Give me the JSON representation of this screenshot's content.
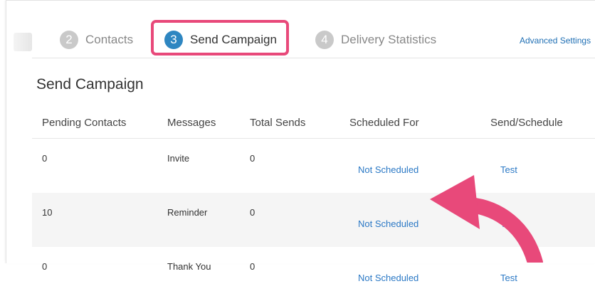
{
  "tabs": [
    {
      "step": "2",
      "label": "Contacts"
    },
    {
      "step": "3",
      "label": "Send Campaign"
    },
    {
      "step": "4",
      "label": "Delivery Statistics"
    }
  ],
  "advanced_settings": "Advanced Settings",
  "section_title": "Send Campaign",
  "table": {
    "headers": [
      "Pending Contacts",
      "Messages",
      "Total Sends",
      "Scheduled For",
      "Send/Schedule"
    ],
    "rows": [
      {
        "pending": "0",
        "message": "Invite",
        "total": "0",
        "scheduled": "Not Scheduled",
        "action": "Test"
      },
      {
        "pending": "10",
        "message": "Reminder",
        "total": "0",
        "scheduled": "Not Scheduled",
        "action": "Test"
      },
      {
        "pending": "0",
        "message": "Thank You",
        "total": "0",
        "scheduled": "Not Scheduled",
        "action": "Test"
      }
    ]
  },
  "colors": {
    "accent": "#2e86c1",
    "highlight": "#e8497a",
    "link": "#2a78c5"
  }
}
